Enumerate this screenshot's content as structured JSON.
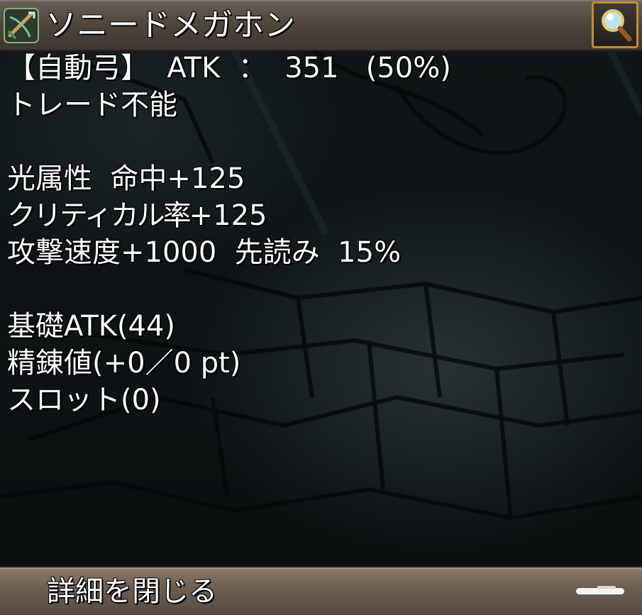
{
  "window": {
    "title": "ソニードメガホン",
    "item_icon": "crossbow-icon",
    "search_icon": "magnifier-icon"
  },
  "info": {
    "weapon_line": "【自動弓】  ATK  ：  351   (50%)",
    "trade_line": "トレード不能",
    "stats": {
      "line1": "光属性  命中+125",
      "line2_prefix": "クリティカル率",
      "line2_value": "+125",
      "line3": "攻撃速度+1000  先読み  15%"
    },
    "details": {
      "base_atk": "基礎ATK(44)",
      "refine": "精錬値(+0／0 pt)",
      "slot": "スロット(0)"
    }
  },
  "footer": {
    "close_label": "詳細を閉じる"
  },
  "colors": {
    "title_bar": "#50473f",
    "search_border": "#c78b2a",
    "bottom_bar": "#6e5f52",
    "text": "#ffffff"
  }
}
